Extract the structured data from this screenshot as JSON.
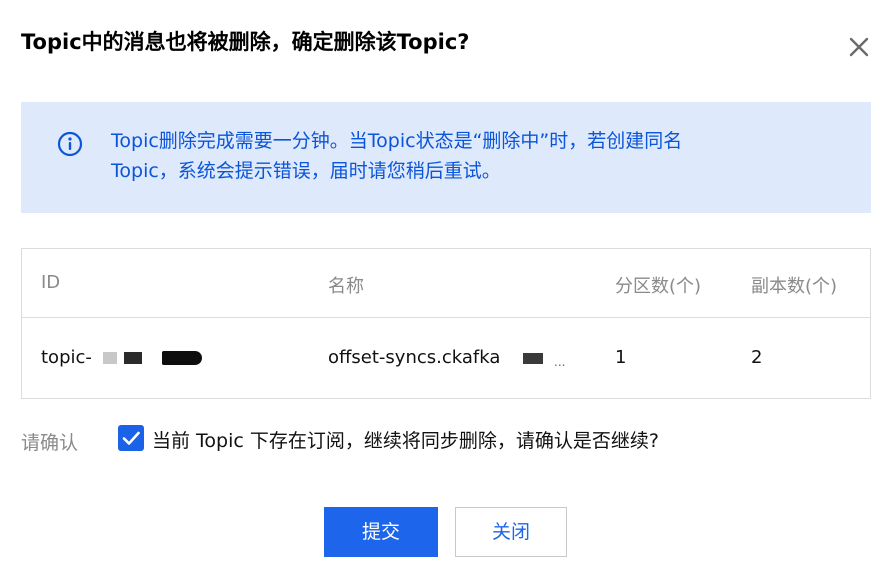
{
  "dialog": {
    "title": "Topic中的消息也将被删除，确定删除该Topic?",
    "close_icon": "close-icon"
  },
  "notice": {
    "icon": "info-icon",
    "accent_color": "#0a55d8",
    "background_color": "#dfe9fc",
    "line1": "Topic删除完成需要一分钟。当Topic状态是“删除中”时，若创建同名",
    "line2": "Topic，系统会提示错误，届时请您稍后重试。"
  },
  "table": {
    "headers": {
      "id": "ID",
      "name": "名称",
      "partitions": "分区数(个)",
      "replicas": "副本数(个)"
    },
    "rows": [
      {
        "id": "topic-",
        "name": "offset-syncs.ckafka",
        "name_suffix": "...",
        "partitions": "1",
        "replicas": "2"
      }
    ]
  },
  "confirm": {
    "label": "请确认",
    "checked": true,
    "checkbox_text": "当前 Topic 下存在订阅，继续将同步删除，请确认是否继续?"
  },
  "buttons": {
    "submit": "提交",
    "close": "关闭",
    "primary_color": "#1d66ec"
  }
}
